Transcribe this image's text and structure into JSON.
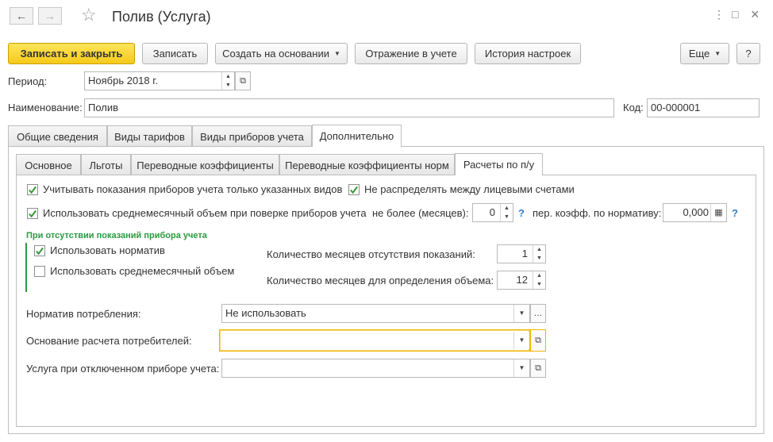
{
  "window": {
    "title": "Полив (Услуга)",
    "back_icon": "←",
    "forward_icon": "→",
    "link_icon": "⋮",
    "menu_icon": "⋮",
    "maximize_icon": "□",
    "close_icon": "×"
  },
  "toolbar": {
    "save_close": "Записать и закрыть",
    "save": "Записать",
    "create_based": "Создать на основании",
    "accounting": "Отражение в учете",
    "history": "История настроек",
    "more": "Еще",
    "help": "?"
  },
  "fields": {
    "period_label": "Период:",
    "period_value": "Ноябрь 2018 г.",
    "name_label": "Наименование:",
    "name_value": "Полив",
    "code_label": "Код:",
    "code_value": "00-000001"
  },
  "tabs": [
    "Общие сведения",
    "Виды тарифов",
    "Виды приборов учета",
    "Дополнительно"
  ],
  "subtabs": [
    "Основное",
    "Льготы",
    "Переводные коэффициенты",
    "Переводные коэффициенты норм",
    "Расчеты по п/у"
  ],
  "options": {
    "only_specified_types": "Учитывать показания приборов учета только указанных видов",
    "no_distribute": "Не распределять между лицевыми счетами",
    "use_avg_on_check": "Использовать среднемесячный объем при поверке приборов учета",
    "max_months_label": "не более (месяцев):",
    "max_months_value": "0",
    "coef_label": "пер. коэфф. по нормативу:",
    "coef_value": "0,000",
    "help_mark": "?"
  },
  "no_readings": {
    "section_title": "При отсутствии показаний прибора учета",
    "use_norm": "Использовать норматив",
    "use_avg": "Использовать среднемесячный объем",
    "months_absent_label": "Количество месяцев отсутствия показаний:",
    "months_absent_value": "1",
    "months_volume_label": "Количество месяцев для определения объема:",
    "months_volume_value": "12"
  },
  "lower": {
    "norm_label": "Норматив потребления:",
    "norm_value": "Не использовать",
    "basis_label": "Основание расчета потребителей:",
    "basis_value": "",
    "service_label": "Услуга при отключенном приборе учета:",
    "service_value": ""
  },
  "checkboxes": {
    "only_specified_types": true,
    "no_distribute": true,
    "use_avg_on_check": true,
    "use_norm": true,
    "use_avg": false
  },
  "colors": {
    "primary": "#f5c918",
    "section": "#2b9a3e",
    "help": "#2e7fc9",
    "focus": "#f0b400"
  }
}
